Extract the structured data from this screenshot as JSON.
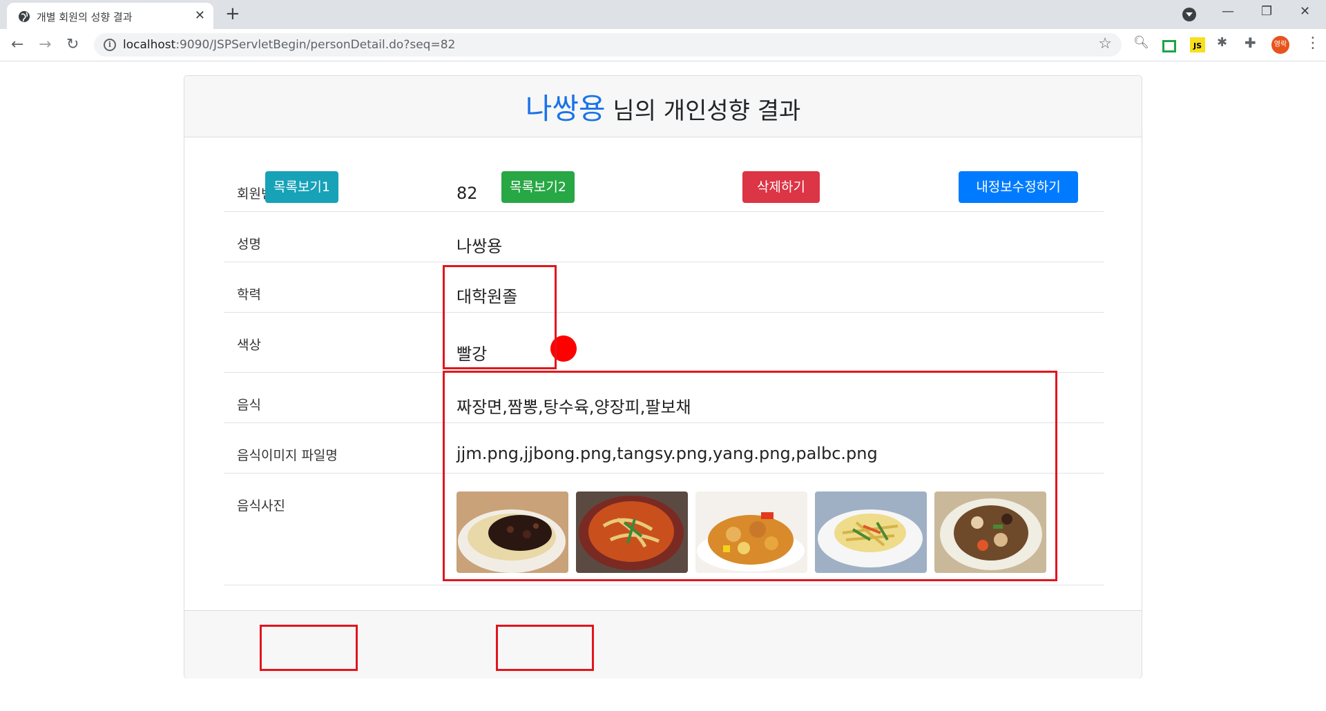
{
  "browser": {
    "tab_title": "개별 회원의 성향 결과",
    "url_host": "localhost",
    "url_rest": ":9090/JSPServletBegin/personDetail.do?seq=82",
    "profile_label": "영락"
  },
  "header": {
    "name": "나쌍용",
    "suffix": " 님의 개인성향 결과"
  },
  "rows": [
    {
      "label": "회원번호",
      "value": "82"
    },
    {
      "label": "성명",
      "value": "나쌍용"
    },
    {
      "label": "학력",
      "value": "대학원졸"
    },
    {
      "label": "색상",
      "value": "빨강",
      "color": "#ff0000"
    },
    {
      "label": "음식",
      "value": "짜장면,짬뽕,탕수육,양장피,팔보채"
    },
    {
      "label": "음식이미지 파일명",
      "value": "jjm.png,jjbong.png,tangsy.png,yang.png,palbc.png"
    },
    {
      "label": "음식사진"
    }
  ],
  "buttons": {
    "list1": "목록보기1",
    "list2": "목록보기2",
    "delete": "삭제하기",
    "edit": "내정보수정하기"
  },
  "colors": {
    "accent_name": "#1a73e8",
    "btn_list1": "#17a2b8",
    "btn_list2": "#28a745",
    "btn_delete": "#dc3545",
    "btn_edit": "#007bff",
    "highlight_box": "#e3141c"
  }
}
